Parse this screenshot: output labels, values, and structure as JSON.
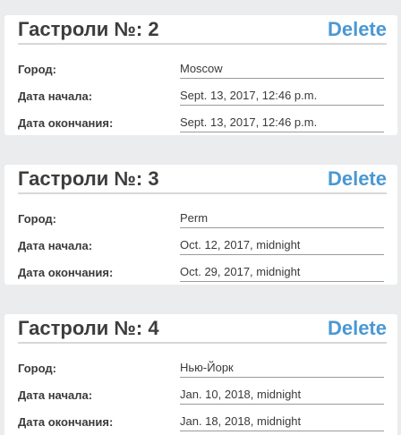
{
  "tours": [
    {
      "title": "Гастроли №: 2",
      "delete_label": "Delete",
      "city_label": "Город:",
      "city": "Moscow",
      "start_label": "Дата начала:",
      "start": "Sept. 13, 2017, 12:46 p.m.",
      "end_label": "Дата окончания:",
      "end": "Sept. 13, 2017, 12:46 p.m."
    },
    {
      "title": "Гастроли №: 3",
      "delete_label": "Delete",
      "city_label": "Город:",
      "city": "Perm",
      "start_label": "Дата начала:",
      "start": "Oct. 12, 2017, midnight",
      "end_label": "Дата окончания:",
      "end": "Oct. 29, 2017, midnight"
    },
    {
      "title": "Гастроли №: 4",
      "delete_label": "Delete",
      "city_label": "Город:",
      "city": "Нью-Йорк",
      "start_label": "Дата начала:",
      "start": "Jan. 10, 2018, midnight",
      "end_label": "Дата окончания:",
      "end": "Jan. 18, 2018, midnight"
    }
  ]
}
